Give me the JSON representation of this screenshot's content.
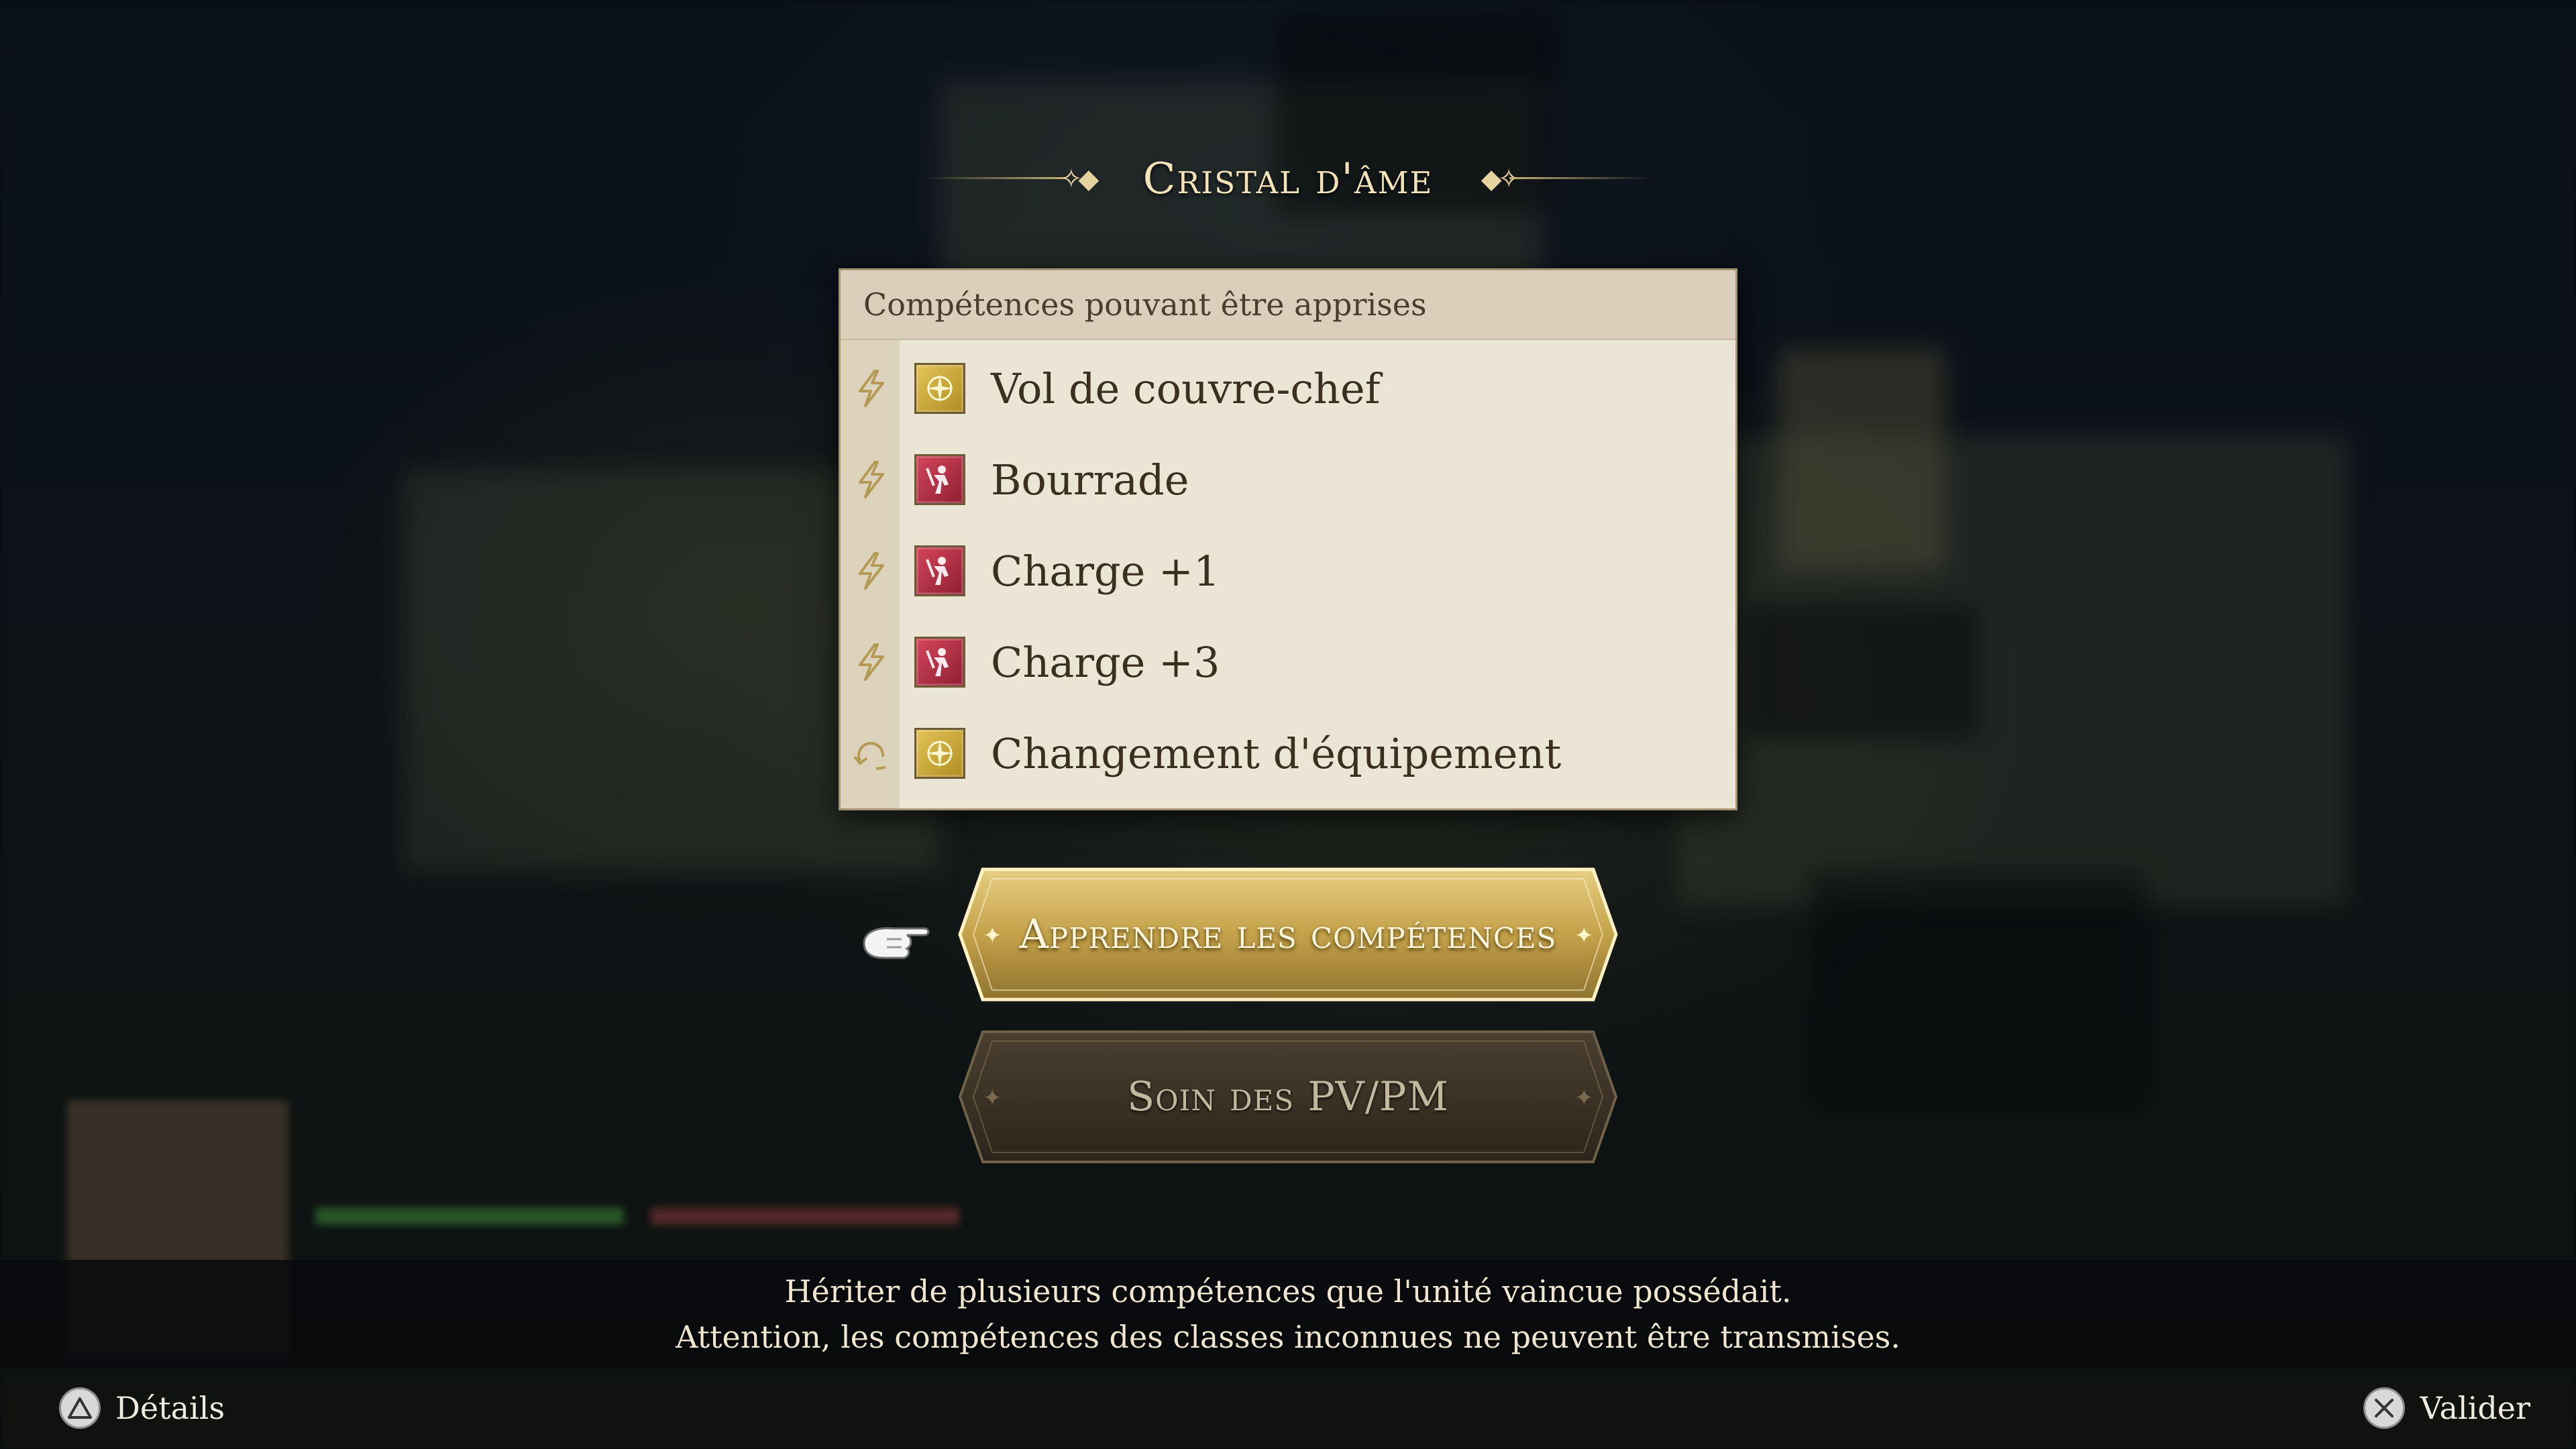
{
  "screen": {
    "title": "Cristal d'âme"
  },
  "skills_panel": {
    "header": "Compétences pouvant être apprises",
    "items": [
      {
        "type_icon": "lightning-icon",
        "skill_icon": "star-crest-icon",
        "icon_color": "gold",
        "name": "Vol de couvre-chef"
      },
      {
        "type_icon": "lightning-icon",
        "skill_icon": "warrior-crest-icon",
        "icon_color": "red",
        "name": "Bourrade"
      },
      {
        "type_icon": "lightning-icon",
        "skill_icon": "warrior-crest-icon",
        "icon_color": "red",
        "name": "Charge +1"
      },
      {
        "type_icon": "lightning-icon",
        "skill_icon": "warrior-crest-icon",
        "icon_color": "red",
        "name": "Charge +3"
      },
      {
        "type_icon": "cycle-icon",
        "skill_icon": "star-crest-icon",
        "icon_color": "gold",
        "name": "Changement d'équipement"
      }
    ]
  },
  "actions": {
    "learn_skills": "Apprendre les compétences",
    "heal": "Soin des PV/PM"
  },
  "description": {
    "line1": "Hériter de plusieurs compétences que l'unité vaincue possédait.",
    "line2": "Attention, les compétences des classes inconnues ne peuvent être transmises."
  },
  "controls": {
    "left": {
      "button_icon": "triangle-button-icon",
      "label": "Détails"
    },
    "right": {
      "button_icon": "cross-button-icon",
      "label": "Valider"
    }
  },
  "colors": {
    "title_gold": "#f3e3b8",
    "panel_bg": "#ebe5d6",
    "panel_header": "#d9cfba",
    "primary_button": "#c9a84e",
    "secondary_button": "#3e3427",
    "icon_gold": "#d4b43f",
    "icon_red": "#b8334a"
  }
}
